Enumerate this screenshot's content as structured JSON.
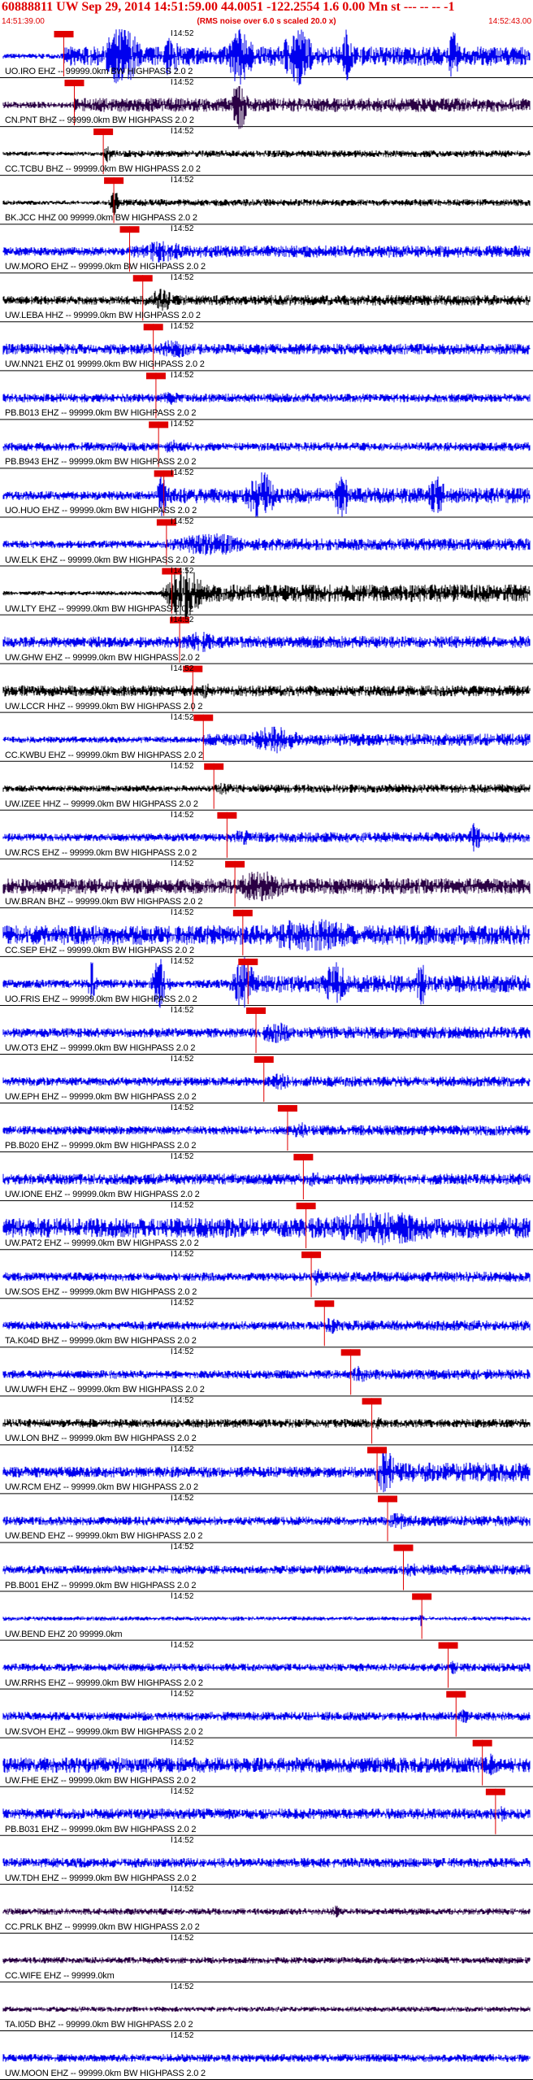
{
  "header": {
    "title": "60888811 UW Sep 29, 2014 14:51:59.00   44.0051 -122.2554  1.6 0.00 Mn st --- -- --  -1",
    "start_time": "14:51:39.00",
    "end_time": "14:52:43.00",
    "note": "(RMS noise over 6.0 s scaled 20.0 x)"
  },
  "tick_label": "14:52",
  "colors": {
    "blue": "#0000ee",
    "purple": "#2a0044",
    "black": "#000000",
    "pick": "#e00000"
  },
  "traces": [
    {
      "label": "UO.IRO EHZ -- 99999.0km BW  HIGHPASS  2.0  2",
      "color": "blue",
      "amp": 0.55,
      "noise": 0.12,
      "pick": 0.115,
      "bursts": [
        [
          0.18,
          0.3,
          2.5
        ],
        [
          0.3,
          0.35,
          2.0
        ],
        [
          0.42,
          0.5,
          2.5
        ],
        [
          0.52,
          0.62,
          2.5
        ],
        [
          0.64,
          0.68,
          2.5
        ],
        [
          0.84,
          0.88,
          2.0
        ]
      ]
    },
    {
      "label": "CN.PNT BHZ -- 99999.0km BW  HIGHPASS  2.0  2",
      "color": "purple",
      "amp": 0.4,
      "noise": 0.15,
      "pick": 0.135,
      "bursts": [
        [
          0.43,
          0.48,
          3.0
        ]
      ]
    },
    {
      "label": "CC.TCBU BHZ -- 99999.0km BW  HIGHPASS  2.0  2",
      "color": "black",
      "amp": 0.2,
      "noise": 0.1,
      "pick": 0.19,
      "bursts": [
        [
          0.19,
          0.21,
          3.0
        ]
      ]
    },
    {
      "label": "BK.JCC HHZ 00 99999.0km BW  HIGHPASS  2.0  2",
      "color": "black",
      "amp": 0.2,
      "noise": 0.1,
      "pick": 0.21,
      "bursts": [
        [
          0.2,
          0.23,
          3.0
        ]
      ]
    },
    {
      "label": "UW.MORO EHZ -- 99999.0km BW  HIGHPASS  2.0  2",
      "color": "blue",
      "amp": 0.35,
      "noise": 0.2,
      "pick": 0.24,
      "bursts": [
        [
          0.24,
          0.4,
          1.5
        ]
      ]
    },
    {
      "label": "UW.LEBA HHZ -- 99999.0km BW  HIGHPASS  2.0  2",
      "color": "black",
      "amp": 0.3,
      "noise": 0.2,
      "pick": 0.265,
      "bursts": [
        [
          0.27,
          0.35,
          1.8
        ]
      ]
    },
    {
      "label": "UW.NN21 EHZ 01 99999.0km BW  HIGHPASS  2.0  2",
      "color": "blue",
      "amp": 0.3,
      "noise": 0.25,
      "pick": 0.285,
      "bursts": [
        [
          0.28,
          0.4,
          1.5
        ]
      ]
    },
    {
      "label": "PB.B013 EHZ -- 99999.0km BW  HIGHPASS  2.0  2",
      "color": "blue",
      "amp": 0.25,
      "noise": 0.2,
      "pick": 0.29,
      "bursts": [
        [
          0.29,
          0.36,
          1.3
        ]
      ]
    },
    {
      "label": "PB.B943 EHZ -- 99999.0km BW  HIGHPASS  2.0  2",
      "color": "blue",
      "amp": 0.25,
      "noise": 0.2,
      "pick": 0.295,
      "bursts": [
        [
          0.29,
          0.38,
          1.3
        ]
      ]
    },
    {
      "label": "UO.HUO EHZ -- 99999.0km BW  HIGHPASS  2.0  2",
      "color": "blue",
      "amp": 0.45,
      "noise": 0.2,
      "pick": 0.305,
      "bursts": [
        [
          0.29,
          0.32,
          2.5
        ],
        [
          0.45,
          0.55,
          2.5
        ],
        [
          0.62,
          0.68,
          2.2
        ],
        [
          0.8,
          0.86,
          2.0
        ]
      ]
    },
    {
      "label": "UW.ELK EHZ -- 99999.0km BW  HIGHPASS  2.0  2",
      "color": "blue",
      "amp": 0.35,
      "noise": 0.18,
      "pick": 0.31,
      "bursts": [
        [
          0.3,
          0.55,
          1.5
        ]
      ]
    },
    {
      "label": "UW.LTY EHZ -- 99999.0km BW  HIGHPASS  2.0  2",
      "color": "black",
      "amp": 0.5,
      "noise": 0.1,
      "pick": 0.32,
      "bursts": [
        [
          0.3,
          0.42,
          2.5
        ]
      ]
    },
    {
      "label": "UW.GHW EHZ -- 99999.0km BW  HIGHPASS  2.0  2",
      "color": "blue",
      "amp": 0.35,
      "noise": 0.25,
      "pick": 0.335,
      "bursts": [
        [
          0.33,
          0.45,
          1.4
        ]
      ]
    },
    {
      "label": "UW.LCCR HHZ -- 99999.0km BW  HIGHPASS  2.0  2",
      "color": "black",
      "amp": 0.3,
      "noise": 0.25,
      "pick": 0.36,
      "bursts": [
        [
          0.36,
          0.42,
          1.2
        ]
      ]
    },
    {
      "label": "CC.KWBU EHZ -- 99999.0km BW  HIGHPASS  2.0  2",
      "color": "blue",
      "amp": 0.35,
      "noise": 0.15,
      "pick": 0.38,
      "bursts": [
        [
          0.45,
          0.62,
          1.8
        ]
      ]
    },
    {
      "label": "UW.IZEE HHZ -- 99999.0km BW  HIGHPASS  2.0  2",
      "color": "black",
      "amp": 0.25,
      "noise": 0.15,
      "pick": 0.4,
      "bursts": [
        [
          0.4,
          0.45,
          1.2
        ]
      ]
    },
    {
      "label": "UW.RCS EHZ -- 99999.0km BW  HIGHPASS  2.0  2",
      "color": "blue",
      "amp": 0.3,
      "noise": 0.18,
      "pick": 0.425,
      "bursts": [
        [
          0.42,
          0.5,
          1.3
        ],
        [
          0.88,
          0.92,
          2.5
        ]
      ]
    },
    {
      "label": "UW.BRAN BHZ -- 99999.0km BW  HIGHPASS  2.0  2",
      "color": "purple",
      "amp": 0.45,
      "noise": 0.35,
      "pick": 0.44,
      "bursts": [
        [
          0.42,
          0.6,
          1.6
        ]
      ]
    },
    {
      "label": "CC.SEP EHZ -- 99999.0km BW  HIGHPASS  2.0  2",
      "color": "blue",
      "amp": 0.55,
      "noise": 0.45,
      "pick": 0.455,
      "bursts": [
        [
          0.45,
          0.8,
          1.4
        ]
      ]
    },
    {
      "label": "UO.FRIS EHZ -- 99999.0km BW  HIGHPASS  2.0  2",
      "color": "blue",
      "amp": 0.5,
      "noise": 0.2,
      "pick": 0.465,
      "bursts": [
        [
          0.16,
          0.18,
          2.5
        ],
        [
          0.28,
          0.32,
          2.5
        ],
        [
          0.43,
          0.5,
          2.5
        ],
        [
          0.6,
          0.68,
          2.0
        ],
        [
          0.78,
          0.82,
          2.0
        ]
      ]
    },
    {
      "label": "UW.OT3 EHZ -- 99999.0km BW  HIGHPASS  2.0  2",
      "color": "blue",
      "amp": 0.35,
      "noise": 0.22,
      "pick": 0.48,
      "bursts": [
        [
          0.47,
          0.6,
          1.4
        ]
      ]
    },
    {
      "label": "UW.EPH EHZ -- 99999.0km BW  HIGHPASS  2.0  2",
      "color": "blue",
      "amp": 0.3,
      "noise": 0.2,
      "pick": 0.495,
      "bursts": [
        [
          0.49,
          0.58,
          1.3
        ]
      ]
    },
    {
      "label": "PB.B020 EHZ -- 99999.0km BW  HIGHPASS  2.0  2",
      "color": "blue",
      "amp": 0.3,
      "noise": 0.2,
      "pick": 0.54,
      "bursts": [
        [
          0.54,
          0.6,
          1.3
        ]
      ]
    },
    {
      "label": "UW.IONE EHZ -- 99999.0km BW  HIGHPASS  2.0  2",
      "color": "blue",
      "amp": 0.3,
      "noise": 0.25,
      "pick": 0.57,
      "bursts": [
        [
          0.57,
          0.62,
          1.3
        ]
      ]
    },
    {
      "label": "UW.PAT2 EHZ -- 99999.0km BW  HIGHPASS  2.0  2",
      "color": "blue",
      "amp": 0.6,
      "noise": 0.45,
      "pick": 0.575,
      "bursts": [
        [
          0.55,
          0.99,
          1.3
        ]
      ]
    },
    {
      "label": "UW.SOS EHZ -- 99999.0km BW  HIGHPASS  2.0  2",
      "color": "blue",
      "amp": 0.3,
      "noise": 0.2,
      "pick": 0.585,
      "bursts": [
        [
          0.58,
          0.62,
          1.4
        ]
      ]
    },
    {
      "label": "TA.K04D BHZ -- 99999.0km BW  HIGHPASS  2.0  2",
      "color": "blue",
      "amp": 0.3,
      "noise": 0.2,
      "pick": 0.61,
      "bursts": [
        [
          0.6,
          0.66,
          1.3
        ]
      ]
    },
    {
      "label": "UW.UWFH EHZ -- 99999.0km BW  HIGHPASS  2.0  2",
      "color": "blue",
      "amp": 0.3,
      "noise": 0.2,
      "pick": 0.66,
      "bursts": [
        [
          0.65,
          0.72,
          1.3
        ]
      ]
    },
    {
      "label": "UW.LON BHZ -- 99999.0km BW  HIGHPASS  2.0  2",
      "color": "black",
      "amp": 0.25,
      "noise": 0.2,
      "pick": 0.7,
      "bursts": [
        [
          0.7,
          0.74,
          1.2
        ]
      ]
    },
    {
      "label": "UW.RCM EHZ -- 99999.0km BW  HIGHPASS  2.0  2",
      "color": "blue",
      "amp": 0.55,
      "noise": 0.25,
      "pick": 0.71,
      "bursts": [
        [
          0.7,
          0.78,
          2.0
        ]
      ]
    },
    {
      "label": "UW.BEND EHZ -- 99999.0km BW  HIGHPASS  2.0  2",
      "color": "blue",
      "amp": 0.3,
      "noise": 0.2,
      "pick": 0.73,
      "bursts": [
        [
          0.72,
          0.8,
          1.3
        ]
      ]
    },
    {
      "label": "PB.B001 EHZ -- 99999.0km BW  HIGHPASS  2.0  2",
      "color": "blue",
      "amp": 0.3,
      "noise": 0.2,
      "pick": 0.76,
      "bursts": [
        [
          0.76,
          0.8,
          1.3
        ]
      ]
    },
    {
      "label": "UW.BEND EHZ 20 99999.0km",
      "color": "blue",
      "amp": 0.12,
      "noise": 0.1,
      "pick": 0.795,
      "bursts": [
        [
          0.79,
          0.8,
          3.0
        ]
      ]
    },
    {
      "label": "UW.RRHS EHZ -- 99999.0km BW  HIGHPASS  2.0  2",
      "color": "blue",
      "amp": 0.25,
      "noise": 0.18,
      "pick": 0.845,
      "bursts": [
        [
          0.84,
          0.88,
          1.3
        ]
      ]
    },
    {
      "label": "UW.SVOH EHZ -- 99999.0km BW  HIGHPASS  2.0  2",
      "color": "blue",
      "amp": 0.25,
      "noise": 0.2,
      "pick": 0.86,
      "bursts": [
        [
          0.86,
          0.9,
          1.3
        ]
      ]
    },
    {
      "label": "UW.FHE EHZ -- 99999.0km BW  HIGHPASS  2.0  2",
      "color": "blue",
      "amp": 0.4,
      "noise": 0.35,
      "pick": 0.91,
      "bursts": [
        [
          0.9,
          0.96,
          1.4
        ]
      ]
    },
    {
      "label": "PB.B031 EHZ -- 99999.0km BW  HIGHPASS  2.0  2",
      "color": "blue",
      "amp": 0.3,
      "noise": 0.25,
      "pick": 0.935,
      "bursts": [
        [
          0.93,
          0.97,
          1.3
        ]
      ]
    },
    {
      "label": "UW.TDH EHZ -- 99999.0km BW  HIGHPASS  2.0  2",
      "color": "blue",
      "amp": 0.25,
      "noise": 0.22,
      "pick": null,
      "bursts": []
    },
    {
      "label": "CC.PRLK BHZ -- 99999.0km BW  HIGHPASS  2.0  2",
      "color": "purple",
      "amp": 0.2,
      "noise": 0.15,
      "pick": null,
      "bursts": [
        [
          0.62,
          0.65,
          1.4
        ]
      ]
    },
    {
      "label": "CC.WIFE EHZ -- 99999.0km",
      "color": "purple",
      "amp": 0.2,
      "noise": 0.15,
      "pick": null,
      "bursts": []
    },
    {
      "label": "TA.I05D BHZ -- 99999.0km BW  HIGHPASS  2.0  2",
      "color": "purple",
      "amp": 0.15,
      "noise": 0.12,
      "pick": null,
      "bursts": []
    },
    {
      "label": "UW.MOON EHZ -- 99999.0km BW  HIGHPASS  2.0  2",
      "color": "blue",
      "amp": 0.2,
      "noise": 0.18,
      "pick": null,
      "bursts": []
    }
  ]
}
